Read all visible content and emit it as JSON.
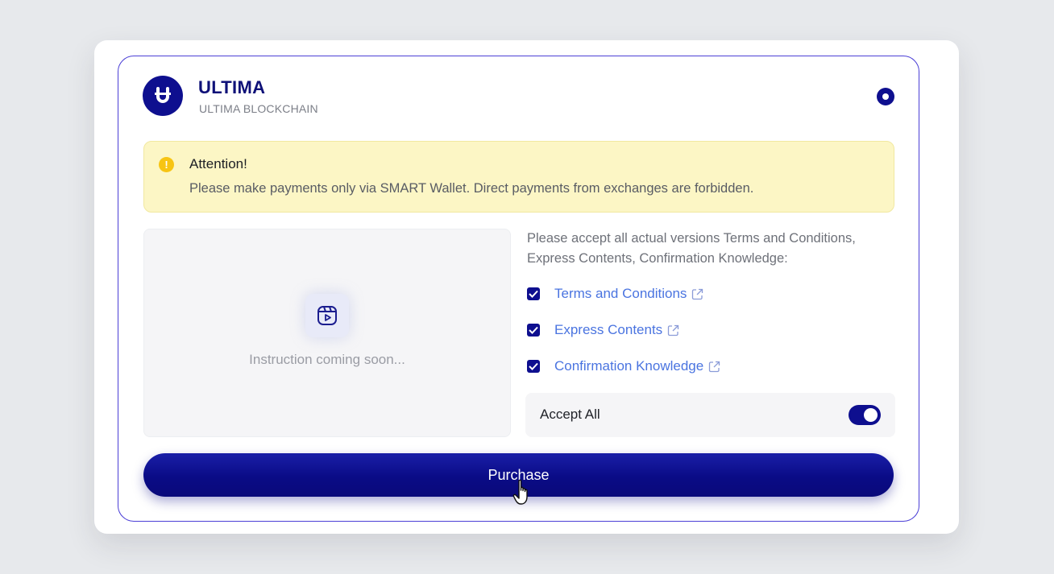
{
  "brand": {
    "title": "ULTIMA",
    "subtitle": "ULTIMA BLOCKCHAIN",
    "logo_icon": "ultima-u-logo-icon"
  },
  "alert": {
    "icon": "warning-icon",
    "title": "Attention!",
    "message": "Please make payments only via SMART Wallet. Direct payments from exchanges are forbidden."
  },
  "instruction": {
    "icon": "video-play-icon",
    "text": "Instruction coming soon..."
  },
  "terms": {
    "intro_line1": "Please accept all actual versions Terms and Conditions,",
    "intro_line2": "Express Contents, Confirmation Knowledge:",
    "items": [
      {
        "label": "Terms and Conditions",
        "checked": true
      },
      {
        "label": "Express Contents",
        "checked": true
      },
      {
        "label": "Confirmation Knowledge",
        "checked": true
      }
    ]
  },
  "accept_all": {
    "label": "Accept All",
    "enabled": true
  },
  "purchase": {
    "label": "Purchase"
  },
  "colors": {
    "brand": "#0e0f8f",
    "border_accent": "#4b3fd6",
    "link": "#4a74e0",
    "alert_bg": "#fcf6c5",
    "alert_icon": "#f7c413"
  }
}
